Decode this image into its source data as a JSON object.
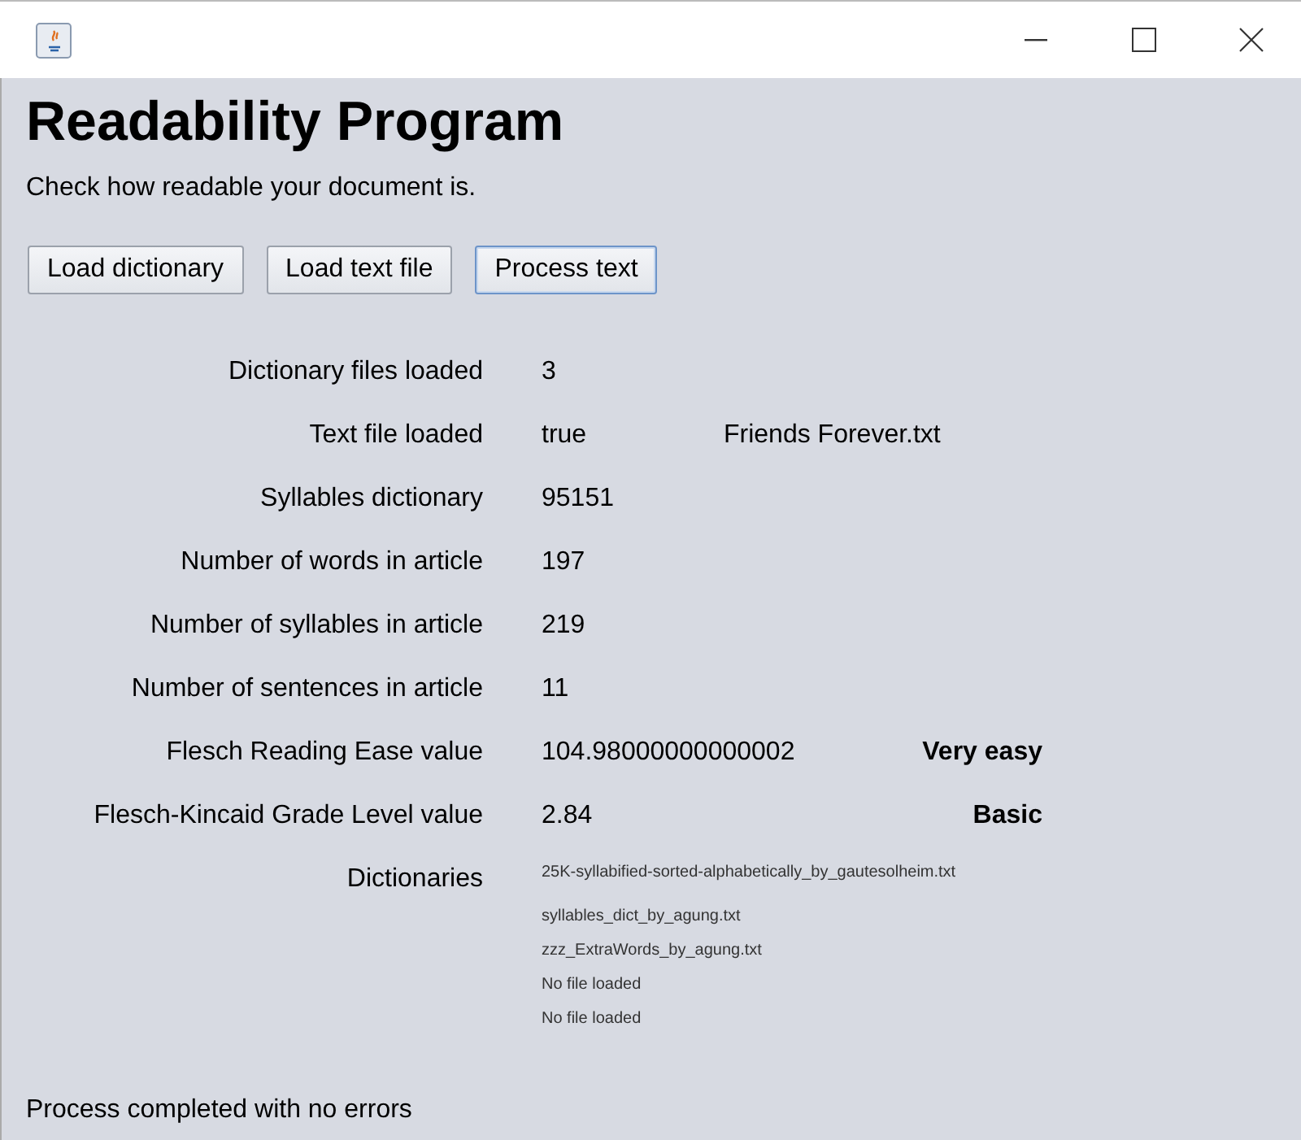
{
  "header": {
    "title": "Readability Program",
    "subtitle": "Check how readable your document is."
  },
  "buttons": [
    {
      "label": "Load dictionary",
      "focused": false
    },
    {
      "label": "Load text file",
      "focused": false
    },
    {
      "label": "Process text",
      "focused": true
    }
  ],
  "results": [
    {
      "label": "Dictionary files loaded",
      "value": "3"
    },
    {
      "label": "Text file loaded",
      "value": "true",
      "extra": {
        "kind": "file",
        "text": "Friends Forever.txt"
      }
    },
    {
      "label": "Syllables dictionary",
      "value": "95151"
    },
    {
      "label": "Number of words in article",
      "value": "197"
    },
    {
      "label": "Number of syllables in article",
      "value": "219"
    },
    {
      "label": "Number of sentences in article",
      "value": "11"
    },
    {
      "label": "Flesch Reading Ease value",
      "value": "104.98000000000002",
      "extra": {
        "kind": "rating",
        "text": "Very easy"
      }
    },
    {
      "label": "Flesch-Kincaid Grade Level value",
      "value": "2.84",
      "extra": {
        "kind": "rating",
        "text": "Basic"
      }
    }
  ],
  "dictionaries": {
    "label": "Dictionaries",
    "files": [
      "25K-syllabified-sorted-alphabetically_by_gautesolheim.txt",
      "syllables_dict_by_agung.txt",
      "zzz_ExtraWords_by_agung.txt",
      "No file loaded",
      "No file loaded"
    ]
  },
  "status_bar": "Process completed with no errors"
}
